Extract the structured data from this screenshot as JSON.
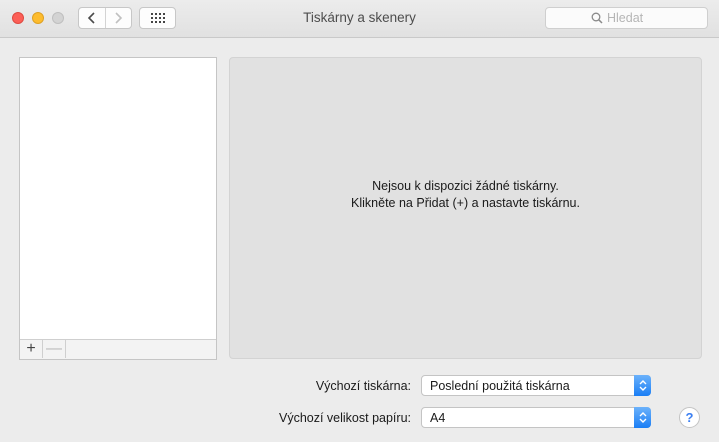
{
  "window": {
    "title": "Tiskárny a skenery"
  },
  "toolbar": {
    "search_placeholder": "Hledat"
  },
  "printer_list": {
    "add_label": "+",
    "remove_label": "—"
  },
  "detail": {
    "empty_line1": "Nejsou k dispozici žádné tiskárny.",
    "empty_line2": "Klikněte na Přidat (+) a nastavte tiskárnu."
  },
  "settings": {
    "default_printer_label": "Výchozí tiskárna:",
    "default_printer_value": "Poslední použitá tiskárna",
    "paper_size_label": "Výchozí velikost papíru:",
    "paper_size_value": "A4"
  },
  "help": {
    "label": "?"
  },
  "colors": {
    "accent": "#1a7ef5",
    "close": "#fc5f57",
    "minimize": "#fdbc2e"
  }
}
